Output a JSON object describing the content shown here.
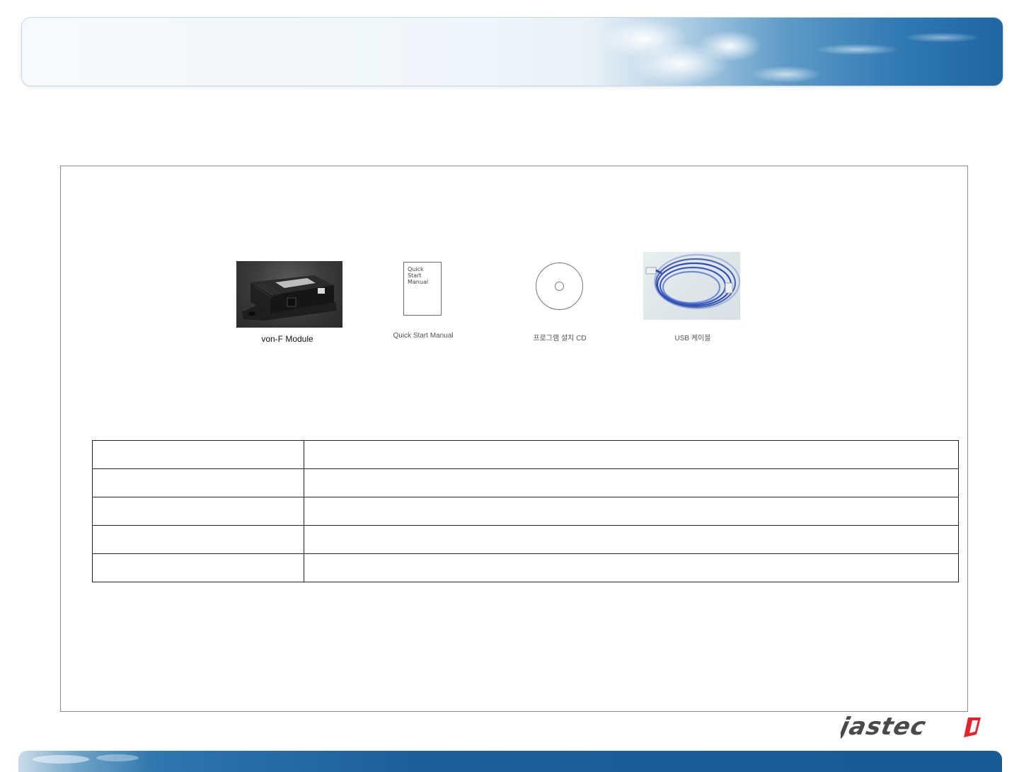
{
  "products": [
    {
      "caption": "von-F Module",
      "icon": "module-photo"
    },
    {
      "caption": "Quick Start Manual",
      "icon": "manual-booklet",
      "cover_text": [
        "Quick",
        "Start",
        "Manual"
      ]
    },
    {
      "caption": "프로그램 설치 CD",
      "icon": "cd-disc"
    },
    {
      "caption": "USB 케이블",
      "icon": "usb-cable-photo"
    }
  ],
  "spec_table": {
    "rows": [
      [
        "",
        ""
      ],
      [
        "",
        ""
      ],
      [
        "",
        ""
      ],
      [
        "",
        ""
      ],
      [
        "",
        ""
      ]
    ]
  },
  "footer": {
    "logo_text": "jastec"
  },
  "colors": {
    "brand_blue": "#1d5f98",
    "logo_red": "#e4232a",
    "logo_gray": "#4a4a4a"
  }
}
